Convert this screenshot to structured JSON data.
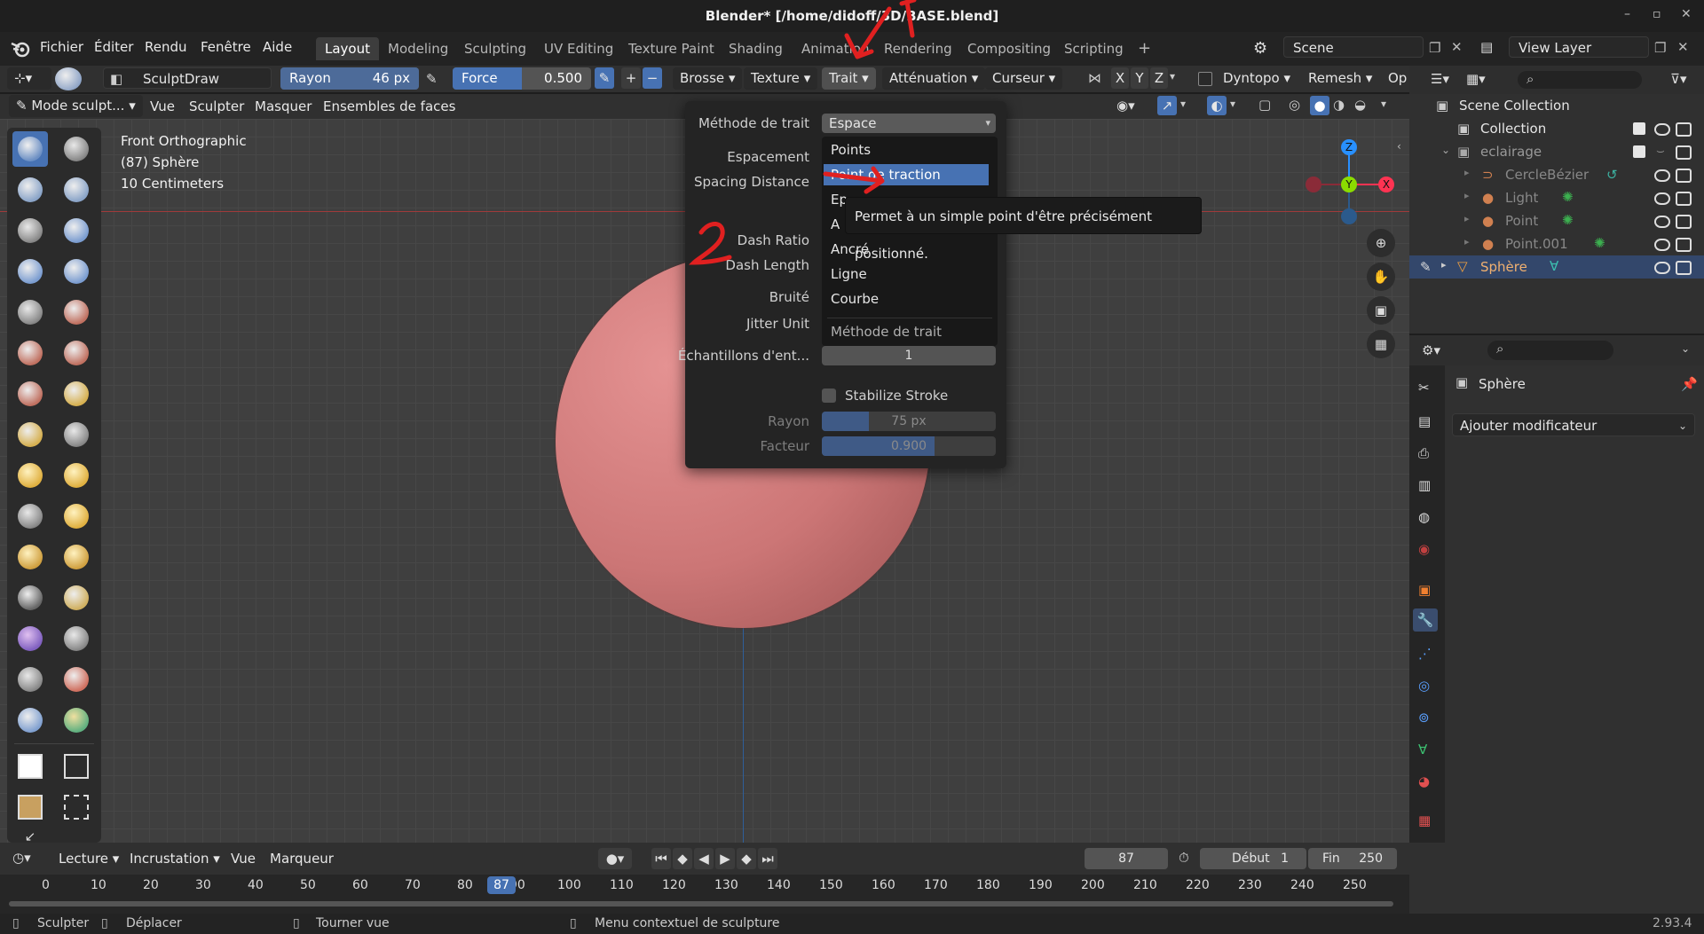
{
  "window": {
    "title": "Blender* [/home/didoff/3D/BASE.blend]",
    "btn_min": "–",
    "btn_max": "▫",
    "btn_close": "✕"
  },
  "menubar": {
    "items": [
      "Fichier",
      "Éditer",
      "Rendu",
      "Fenêtre",
      "Aide"
    ],
    "tabs": [
      "Layout",
      "Modeling",
      "Sculpting",
      "UV Editing",
      "Texture Paint",
      "Shading",
      "Animation",
      "Rendering",
      "Compositing",
      "Scripting"
    ],
    "add_tab": "+",
    "scene": "Scene",
    "view_layer": "View Layer"
  },
  "toolheader": {
    "brush_name": "SculptDraw",
    "radius_label": "Rayon",
    "radius_value": "46 px",
    "strength_label": "Force",
    "strength_value": "0.500",
    "strength_fraction": 0.5,
    "plus": "+",
    "minus": "−",
    "dropdowns": [
      "Brosse",
      "Texture",
      "Trait",
      "Atténuation",
      "Curseur"
    ],
    "axes": [
      "X",
      "Y",
      "Z"
    ],
    "dyntopo": "Dyntopo",
    "remesh": "Remesh",
    "options": "Op"
  },
  "modeheader": {
    "mode": "Mode sculpt...",
    "items": [
      "Vue",
      "Sculpter",
      "Masquer",
      "Ensembles de faces"
    ]
  },
  "viewport": {
    "view_name": "Front Orthographic",
    "object_line": "(87) Sphère",
    "scale_line": "10 Centimeters",
    "gizmo": {
      "z": "Z",
      "y": "Y",
      "x": "X"
    }
  },
  "popup": {
    "stroke_method_label": "Méthode de trait",
    "stroke_method_value": "Espace",
    "labels": [
      "Espacement",
      "Spacing Distance",
      "Dash Ratio",
      "Dash Length",
      "Bruité",
      "Jitter Unit",
      "Échantillons d'ent..."
    ],
    "samples_value": "1",
    "stabilize_label": "Stabilize Stroke",
    "radius_label": "Rayon",
    "radius_value": "75 px",
    "radius_fraction": 0.27,
    "factor_label": "Facteur",
    "factor_value": "0.900",
    "factor_fraction": 0.65,
    "menu_items": [
      "Points",
      "Point de traction",
      "Espace",
      "Aérographe",
      "Ancré",
      "Ligne",
      "Courbe"
    ],
    "menu_items_visible": [
      "Points",
      "Point de traction",
      "Ep",
      "A",
      "Ancré",
      "Ligne",
      "Courbe"
    ],
    "menu_footer": "Méthode de trait",
    "tooltip": "Permet à un simple point d'être précisément positionné."
  },
  "annotations": {
    "one": "1",
    "two": "2"
  },
  "outliner": {
    "rows": [
      {
        "name": "Scene Collection"
      },
      {
        "name": "Collection"
      },
      {
        "name": "eclairage"
      },
      {
        "name": "CercleBézier"
      },
      {
        "name": "Light"
      },
      {
        "name": "Point"
      },
      {
        "name": "Point.001"
      },
      {
        "name": "Sphère"
      }
    ]
  },
  "properties": {
    "object_name": "Sphère",
    "add_modifier": "Ajouter modificateur"
  },
  "timeline": {
    "header": [
      "Lecture",
      "Incrustation",
      "Vue",
      "Marqueur"
    ],
    "current_frame": "87",
    "start_label": "Début",
    "start_value": "1",
    "end_label": "Fin",
    "end_value": "250",
    "ticks": [
      "0",
      "10",
      "20",
      "30",
      "40",
      "50",
      "60",
      "70",
      "80",
      "90",
      "100",
      "110",
      "120",
      "130",
      "140",
      "150",
      "160",
      "170",
      "180",
      "190",
      "200",
      "210",
      "220",
      "230",
      "240",
      "250"
    ],
    "cursor_frame": "87"
  },
  "statusbar": {
    "sculpt": "Sculpter",
    "move": "Déplacer",
    "rotate": "Tourner vue",
    "context": "Menu contextuel de sculpture",
    "version": "2.93.4"
  },
  "colors": {
    "accent": "#4772b3",
    "sphere": "#d88080",
    "annotation": "#e02020",
    "axis_x": "#ff3352",
    "axis_y": "#8bdc00",
    "axis_z": "#2890ff"
  }
}
